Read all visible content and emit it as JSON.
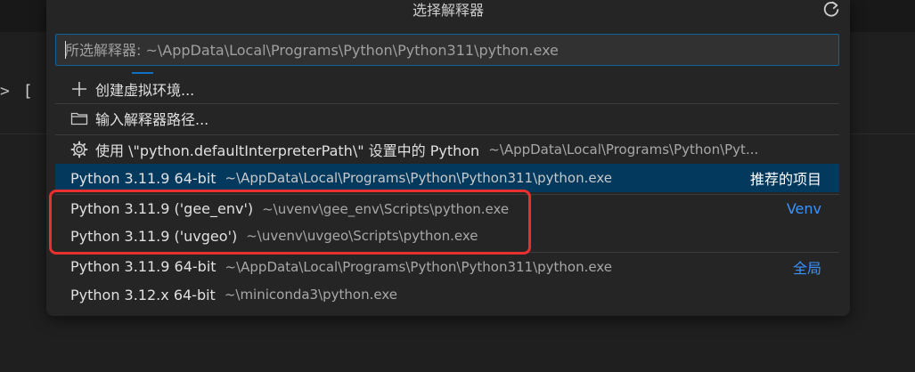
{
  "background": {
    "snippet_chevron": ">",
    "snippet_text": "[ ] p"
  },
  "picker": {
    "title": "选择解释器",
    "search": {
      "value": "",
      "placeholder": "所选解释器: ~\\AppData\\Local\\Programs\\Python\\Python311\\python.exe"
    },
    "items": [
      {
        "icon": "plus-icon",
        "label": "创建虚拟环境...",
        "desc": "",
        "tag": ""
      },
      {
        "icon": "folder-icon",
        "label": "输入解释器路径...",
        "desc": "",
        "tag": ""
      },
      {
        "icon": "gear-icon",
        "label": "使用 \\\"python.defaultInterpreterPath\\\" 设置中的 Python",
        "desc": "~\\AppData\\Local\\Programs\\Python\\Pyt...",
        "tag": ""
      },
      {
        "icon": "",
        "label": "Python 3.11.9 64-bit",
        "desc": "~\\AppData\\Local\\Programs\\Python\\Python311\\python.exe",
        "tag": "推荐的项目"
      },
      {
        "icon": "",
        "label": "Python 3.11.9 ('gee_env')",
        "desc": "~\\uvenv\\gee_env\\Scripts\\python.exe",
        "tag": "Venv"
      },
      {
        "icon": "",
        "label": "Python 3.11.9 ('uvgeo')",
        "desc": "~\\uvenv\\uvgeo\\Scripts\\python.exe",
        "tag": ""
      },
      {
        "icon": "",
        "label": "Python 3.11.9 64-bit",
        "desc": "~\\AppData\\Local\\Programs\\Python\\Python311\\python.exe",
        "tag": "全局"
      },
      {
        "icon": "",
        "label": "Python 3.12.x 64-bit",
        "desc": "~\\miniconda3\\python.exe",
        "tag": ""
      }
    ]
  },
  "colors": {
    "accent": "#0e639c",
    "selected_bg": "#04395e",
    "tag_blue": "#3794ff",
    "highlight_red": "#e8302f"
  }
}
